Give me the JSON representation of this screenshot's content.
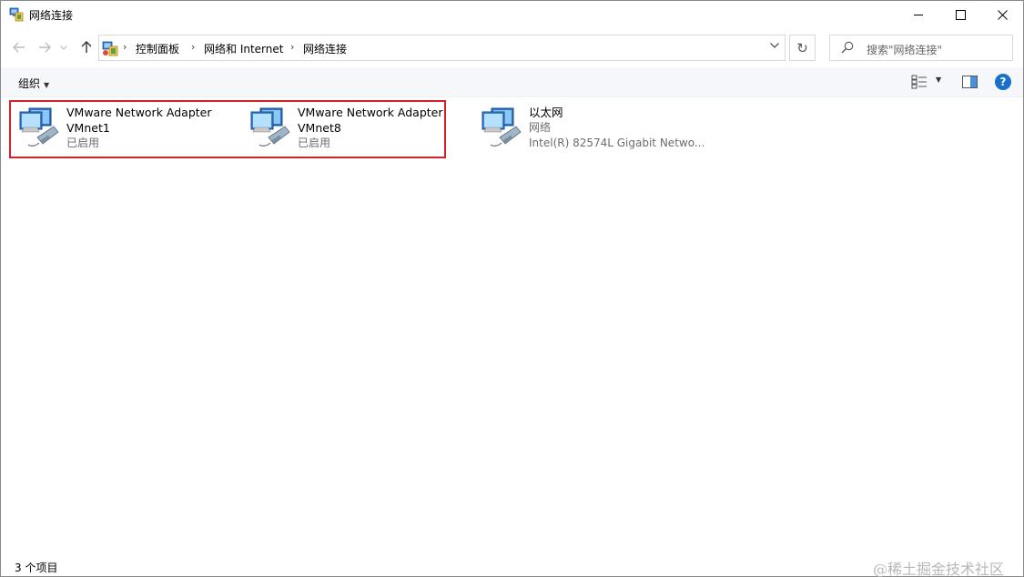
{
  "window": {
    "title": "网络连接",
    "minimize": "—",
    "maximize": "☐",
    "close": "✕"
  },
  "nav": {
    "back": "←",
    "forward": "→",
    "recent": "∨",
    "up": "↑",
    "breadcrumbs": [
      "控制面板",
      "网络和 Internet",
      "网络连接"
    ],
    "separator": "›",
    "dropdown": "∨",
    "refresh": "↻",
    "search_placeholder": "搜索\"网络连接\""
  },
  "commandbar": {
    "organize_label": "组织",
    "organize_caret": "▼",
    "view_caret": "▼",
    "help": "?"
  },
  "items": [
    {
      "name": "VMware Network Adapter",
      "subtitle": "VMnet1",
      "status": "已启用"
    },
    {
      "name": "VMware Network Adapter",
      "subtitle": "VMnet8",
      "status": "已启用"
    },
    {
      "name": "以太网",
      "subtitle": "网络",
      "status": "Intel(R) 82574L Gigabit Netwo..."
    }
  ],
  "statusbar": {
    "count": "3 个项目",
    "watermark": "@稀土掘金技术社区"
  },
  "colors": {
    "highlight_border": "#d42027",
    "help_blue": "#1a6fcb",
    "cmdbar_bg": "#f5f7fa"
  },
  "icons": [
    "network-connection-icon",
    "control-panel-icon",
    "search-icon",
    "view-options-icon",
    "preview-pane-icon",
    "help-icon",
    "network-adapter-icon"
  ]
}
